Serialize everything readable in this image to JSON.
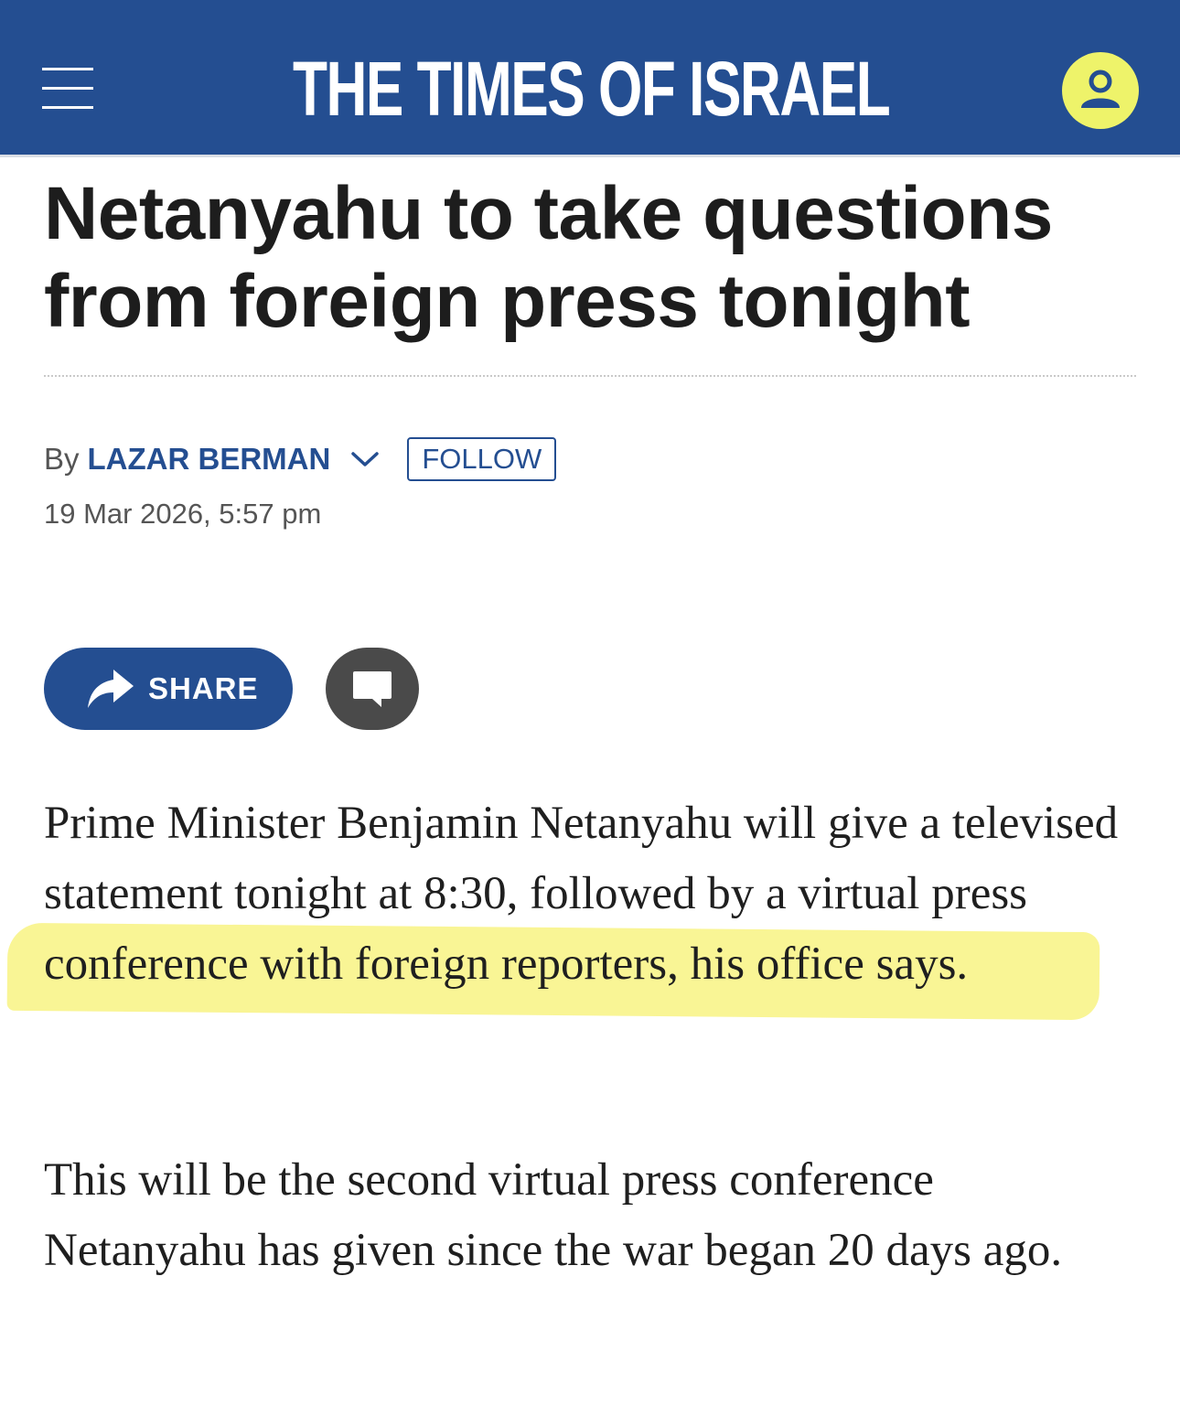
{
  "header": {
    "logo_text": "THE TIMES OF ISRAEL",
    "menu_icon": "hamburger-menu-icon",
    "account_icon": "user-account-icon",
    "bar_color": "#244e91",
    "account_color": "#eef36a"
  },
  "article": {
    "headline": "Netanyahu to take questions from foreign press tonight",
    "byline": {
      "by_label": "By",
      "author": "LAZAR BERMAN",
      "follow_label": "FOLLOW"
    },
    "date": "19 Mar 2026, 5:57 pm",
    "share_label": "SHARE",
    "share_icon": "share-arrow-icon",
    "comments_icon": "comment-bubble-icon",
    "paragraphs": [
      "Prime Minister Benjamin Netanyahu will give a televised statement tonight at 8:30, followed by a virtual press conference with foreign reporters, his office says.",
      "This will be the second virtual press conference Netanyahu has given since the war began 20 days ago."
    ],
    "highlight_color": "#f8f48a"
  }
}
